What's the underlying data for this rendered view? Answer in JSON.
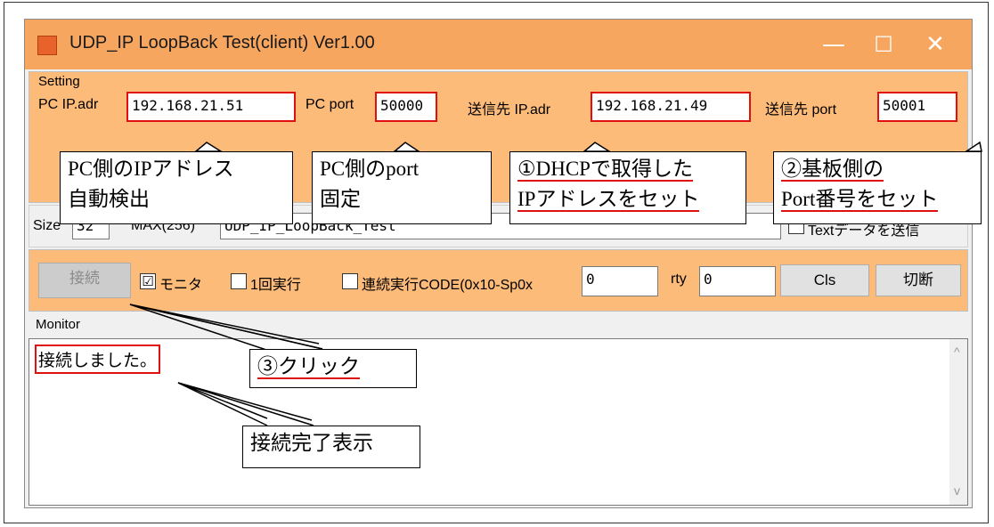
{
  "window": {
    "title": "UDP_IP LoopBack Test(client) Ver1.00",
    "minimize": "—",
    "maximize": "☐",
    "close": "✕"
  },
  "setting": {
    "group_label": "Setting",
    "pc_ip_label": "PC IP.adr",
    "pc_ip_value": "192.168.21.51",
    "pc_port_label": "PC port",
    "pc_port_value": "50000",
    "dest_ip_label": "送信先 IP.adr",
    "dest_ip_value": "192.168.21.49",
    "dest_port_label": "送信先 port",
    "dest_port_value": "50001"
  },
  "data": {
    "size_label": "Size",
    "size_value": "32",
    "max_label": "MAX(256)",
    "text_value": "UDP_IP_LoopBack_Test",
    "text_check_label": "Textデータを送信"
  },
  "controls": {
    "connect_label": "接続",
    "monitor_check_label": "モニタ",
    "monitor_checked": "☑",
    "once_label": "1回実行",
    "continuous_label": "連続実行CODE(0x10-Sp0x",
    "code_value": "0",
    "rty_label": "rty",
    "rty_value": "0",
    "cls_label": "Cls",
    "disconnect_label": "切断"
  },
  "monitor": {
    "group_label": "Monitor",
    "text": "接続しました。",
    "scroll_up": "^",
    "scroll_down": "v"
  },
  "callouts": {
    "c1_line1": "PC側のIPアドレス",
    "c1_line2": "自動検出",
    "c2_line1": "PC側のport",
    "c2_line2": "固定",
    "c3_line1": "①DHCPで取得した",
    "c3_line2": "IPアドレスをセット",
    "c4_line1": "②基板側の",
    "c4_line2": "Port番号をセット",
    "c5": "③クリック",
    "c6": "接続完了表示"
  },
  "colors": {
    "titlebar": "#f7a660",
    "panel": "#fdbb7a",
    "highlight_red": "#e01010"
  }
}
